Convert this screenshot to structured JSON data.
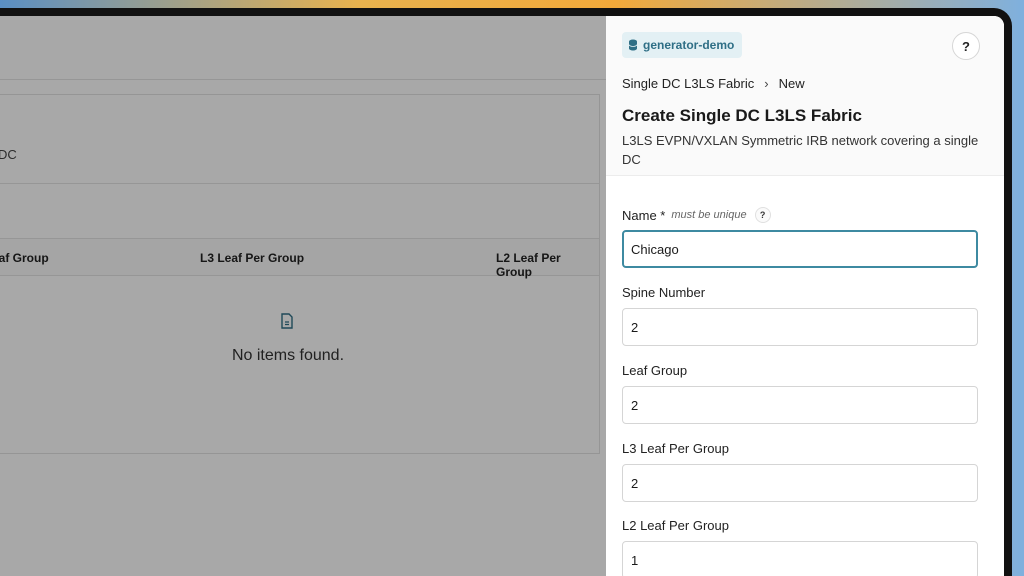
{
  "background": {
    "description_fragment": "DC",
    "table": {
      "headers": [
        "eaf Group",
        "L3 Leaf Per Group",
        "L2 Leaf Per Group"
      ]
    },
    "empty_text": "No items found."
  },
  "drawer": {
    "badge_label": "generator-demo",
    "help_label": "?",
    "breadcrumb": {
      "parent": "Single DC L3LS Fabric",
      "separator": "›",
      "current": "New"
    },
    "title": "Create Single DC L3LS Fabric",
    "subtitle": "L3LS EVPN/VXLAN Symmetric IRB network covering a single DC",
    "form": {
      "name": {
        "label": "Name *",
        "hint": "must be unique",
        "help": "?",
        "value": "Chicago"
      },
      "spine_number": {
        "label": "Spine Number",
        "value": "2"
      },
      "leaf_group": {
        "label": "Leaf Group",
        "value": "2"
      },
      "l3_leaf_per_group": {
        "label": "L3 Leaf Per Group",
        "value": "2"
      },
      "l2_leaf_per_group": {
        "label": "L2 Leaf Per Group",
        "value": "1"
      }
    }
  },
  "colors": {
    "accent": "#3e8aa1",
    "badge_bg": "#e3f0f4",
    "badge_text": "#2f6f86"
  },
  "icons": {
    "badge": "database-icon",
    "empty": "file-icon"
  }
}
